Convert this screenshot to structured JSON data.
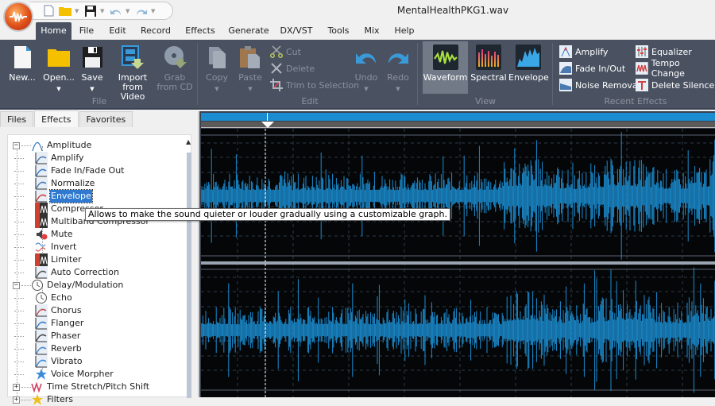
{
  "window": {
    "title": "MentalHealthPKG1.wav"
  },
  "quick_access": {
    "icons": [
      "new-file-icon",
      "open-folder-icon",
      "save-icon",
      "undo-icon",
      "redo-icon"
    ]
  },
  "menu": {
    "tabs": [
      "Home",
      "File",
      "Edit",
      "Record",
      "Effects",
      "Generate",
      "DX/VST",
      "Tools",
      "Mix",
      "Help"
    ],
    "active": "Home"
  },
  "ribbon": {
    "file_group": {
      "label": "File",
      "buttons": [
        {
          "label": "New...",
          "enabled": true
        },
        {
          "label": "Open...",
          "enabled": true,
          "dropdown": true
        },
        {
          "label": "Save",
          "enabled": true,
          "dropdown": true
        },
        {
          "label": "Import\nfrom Video",
          "line1": "Import",
          "line2": "from Video",
          "enabled": true
        },
        {
          "label": "Grab\nfrom CD",
          "line1": "Grab",
          "line2": "from CD",
          "enabled": false
        }
      ]
    },
    "edit_group": {
      "label": "Edit",
      "buttons": [
        {
          "label": "Copy",
          "enabled": false
        },
        {
          "label": "Paste",
          "enabled": false
        },
        {
          "label": "Cut",
          "enabled": false
        },
        {
          "label": "Delete",
          "enabled": false
        },
        {
          "label": "Trim to Selection",
          "enabled": false
        },
        {
          "label": "Undo",
          "enabled": false
        },
        {
          "label": "Redo",
          "enabled": false
        }
      ]
    },
    "view_group": {
      "label": "View",
      "buttons": [
        {
          "label": "Waveform",
          "active": true
        },
        {
          "label": "Spectral",
          "active": false
        },
        {
          "label": "Envelope",
          "active": false
        }
      ]
    },
    "recent_effects": {
      "label": "Recent Effects",
      "items": [
        "Amplify",
        "Equalizer",
        "Fade In/Out",
        "Tempo Change",
        "Noise Removal",
        "Delete Silence"
      ]
    }
  },
  "left_panel": {
    "tabs": [
      "Files",
      "Effects",
      "Favorites"
    ],
    "active_tab": "Effects",
    "tree": [
      {
        "label": "Amplitude",
        "level": 0,
        "expanded": true
      },
      {
        "label": "Amplify",
        "level": 1
      },
      {
        "label": "Fade In/Fade Out",
        "level": 1
      },
      {
        "label": "Normalize",
        "level": 1
      },
      {
        "label": "Envelope",
        "level": 1,
        "selected": true
      },
      {
        "label": "Compressor",
        "level": 1
      },
      {
        "label": "Multiband Compressor",
        "level": 1
      },
      {
        "label": "Mute",
        "level": 1
      },
      {
        "label": "Invert",
        "level": 1
      },
      {
        "label": "Limiter",
        "level": 1
      },
      {
        "label": "Auto Correction",
        "level": 1
      },
      {
        "label": "Delay/Modulation",
        "level": 0,
        "expanded": true
      },
      {
        "label": "Echo",
        "level": 1
      },
      {
        "label": "Chorus",
        "level": 1
      },
      {
        "label": "Flanger",
        "level": 1
      },
      {
        "label": "Phaser",
        "level": 1
      },
      {
        "label": "Reverb",
        "level": 1
      },
      {
        "label": "Vibrato",
        "level": 1
      },
      {
        "label": "Voice Morpher",
        "level": 1
      },
      {
        "label": "Time Stretch/Pitch Shift",
        "level": 0,
        "expanded": false
      },
      {
        "label": "Filters",
        "level": 0,
        "expanded": false
      }
    ]
  },
  "tooltip": {
    "text": "Allows to make the sound quieter or louder gradually using a customizable graph."
  },
  "waveform": {
    "color": "#1b8ccf",
    "channels": 2,
    "playhead_fraction": 0.125
  }
}
